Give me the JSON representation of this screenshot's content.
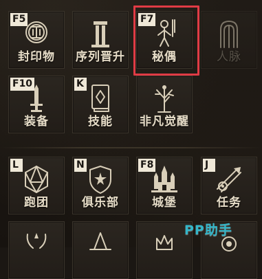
{
  "tiles": {
    "seal": {
      "hotkey": "F5",
      "label": "封印物",
      "icon": "seal-icon"
    },
    "sequence": {
      "hotkey": "",
      "label": "序列晋升",
      "icon": "pillar-icon"
    },
    "secret_puppet": {
      "hotkey": "F7",
      "label": "秘偶",
      "icon": "puppet-icon"
    },
    "relations": {
      "hotkey": "",
      "label": "人脉",
      "icon": "doorway-icon"
    },
    "equipment": {
      "hotkey": "F10",
      "label": "装备",
      "icon": "sword-icon"
    },
    "skills": {
      "hotkey": "K",
      "label": "技能",
      "icon": "book-icon"
    },
    "beyonder": {
      "hotkey": "",
      "label": "非凡觉醒",
      "icon": "tree-icon"
    },
    "team": {
      "hotkey": "L",
      "label": "跑团",
      "icon": "d20-icon"
    },
    "club": {
      "hotkey": "N",
      "label": "俱乐部",
      "icon": "shield-icon"
    },
    "castle": {
      "hotkey": "F8",
      "label": "城堡",
      "icon": "castle-icon"
    },
    "quests": {
      "hotkey": "J",
      "label": "任务",
      "icon": "swords-icon"
    }
  },
  "watermark": "PP助手",
  "colors": {
    "highlight": "#e03b45",
    "watermark": "#33b6c9",
    "hotkey_bg": "#efe8d8"
  }
}
